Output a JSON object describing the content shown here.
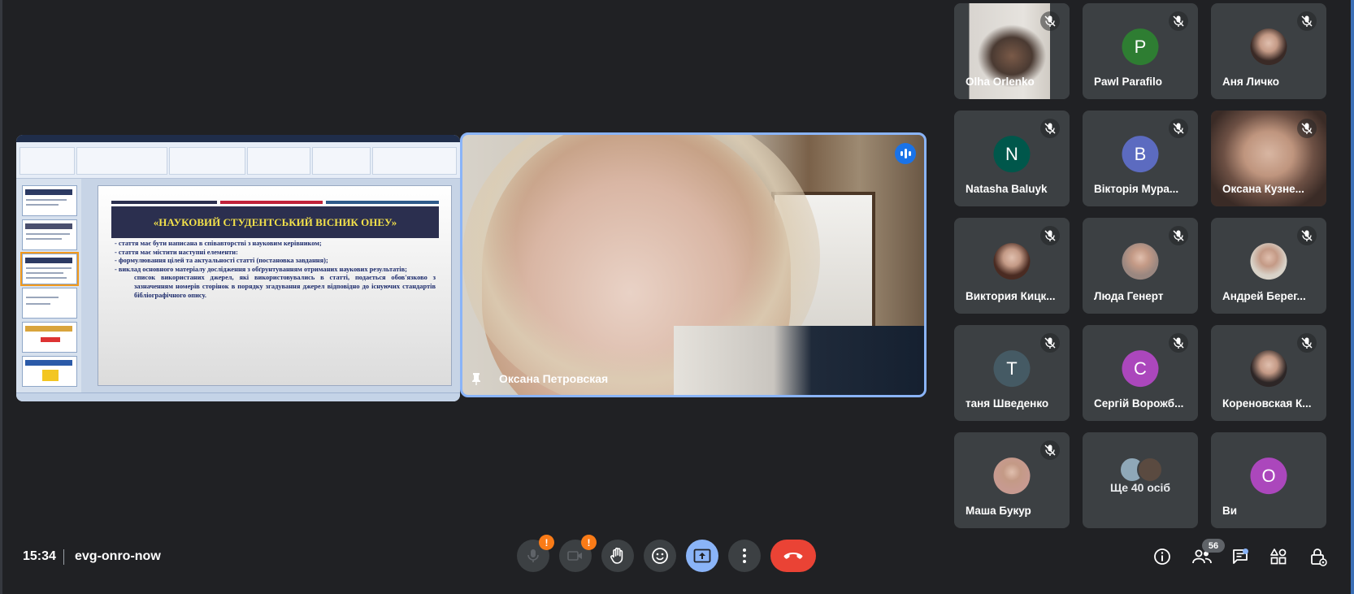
{
  "meeting": {
    "time": "15:34",
    "code": "evg-onro-now"
  },
  "presentation": {
    "slide_title": "«НАУКОВИЙ СТУДЕНТСЬКИЙ ВІСНИК ОНЕУ»",
    "slide_lines": [
      "- стаття має бути  написана в співавторстві з науковим керівником;",
      "- стаття  має містити наступні елементи:",
      "- формулювання цілей  та актуальності статті (постановка завдання);",
      "- виклад основного матеріалу дослідження з обґрунтуванням отриманих наукових результатів;",
      "список використаних джерел, які використовувались в статті, подається обов'язково з зазначенням номерів сторінок в порядку згадування джерел відповідно до існуючих стандартів бібліографічного опису."
    ]
  },
  "main_speaker": {
    "name": "Оксана Петровская"
  },
  "participants": [
    {
      "name": "Olha Orlenko",
      "type": "video"
    },
    {
      "name": "Pawl Parafilo",
      "type": "initial",
      "initial": "P",
      "color": "#2e7d32"
    },
    {
      "name": "Аня Личко",
      "type": "photo",
      "color": "#3a2a26"
    },
    {
      "name": "Natasha Baluyk",
      "type": "initial",
      "initial": "N",
      "color": "#00574b"
    },
    {
      "name": "Вікторія Мура...",
      "type": "initial",
      "initial": "B",
      "color": "#5c6bc0"
    },
    {
      "name": "Оксана Кузне...",
      "type": "video"
    },
    {
      "name": "Виктория Кицк...",
      "type": "photo",
      "color": "#4a2b22"
    },
    {
      "name": "Люда Генерт",
      "type": "photo",
      "color": "#9a8780"
    },
    {
      "name": "Андрей Берег...",
      "type": "photo",
      "color": "#d8d2c8"
    },
    {
      "name": "таня Шведенко",
      "type": "initial",
      "initial": "T",
      "color": "#455a64"
    },
    {
      "name": "Сергій Ворожб...",
      "type": "initial",
      "initial": "C",
      "color": "#ab47bc"
    },
    {
      "name": "Кореновская К...",
      "type": "photo",
      "color": "#2d2626"
    },
    {
      "name": "Маша Букур",
      "type": "photo",
      "color": "#c79a90"
    },
    {
      "name": "Ще 40 осіб",
      "type": "others"
    },
    {
      "name": "Ви",
      "type": "initial",
      "initial": "O",
      "color": "#ab47bc"
    }
  ],
  "controls": {
    "people_count": "56",
    "warning_mark": "!"
  },
  "icons": {
    "mic": "mic-off-icon",
    "camera": "camera-off-icon",
    "hand": "raise-hand-icon",
    "emoji": "emoji-icon",
    "present": "present-screen-icon",
    "more": "more-vert-icon",
    "end": "end-call-icon",
    "info": "info-icon",
    "people": "people-icon",
    "chat": "chat-icon",
    "activities": "activities-icon",
    "host": "host-controls-icon"
  },
  "colors": {
    "background": "#202124",
    "tile": "#3c4043",
    "accent": "#8ab4f8",
    "end_call": "#ea4335",
    "warning": "#fa7b17",
    "speaking": "#1a73e8"
  }
}
